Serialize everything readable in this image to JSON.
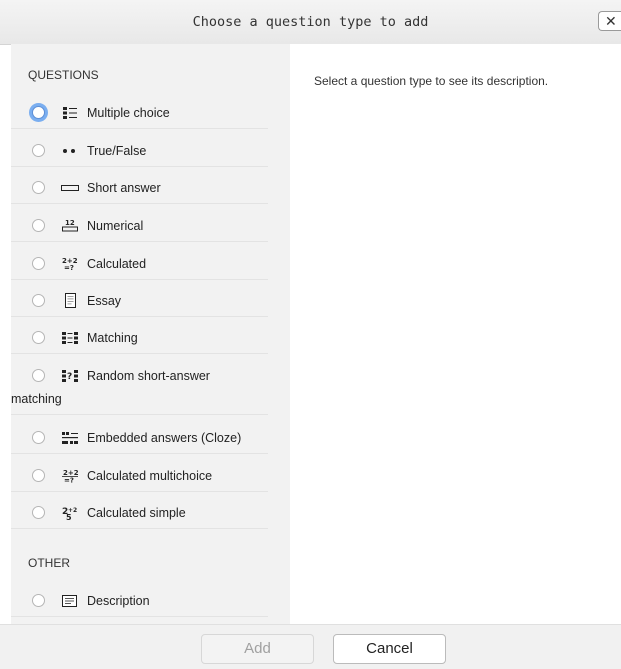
{
  "dialog": {
    "title": "Choose a question type to add",
    "close_label": "✕"
  },
  "categories": {
    "questions": "QUESTIONS",
    "other": "OTHER"
  },
  "options": [
    {
      "label": "Multiple choice",
      "icon": "multichoice-icon"
    },
    {
      "label": "True/False",
      "icon": "truefalse-icon"
    },
    {
      "label": "Short answer",
      "icon": "shortanswer-icon"
    },
    {
      "label": "Numerical",
      "icon": "numerical-icon"
    },
    {
      "label": "Calculated",
      "icon": "calculated-icon"
    },
    {
      "label": "Essay",
      "icon": "essay-icon"
    },
    {
      "label": "Matching",
      "icon": "matching-icon"
    },
    {
      "label": "Random short-answer",
      "label_line2": "matching",
      "icon": "randomsamatch-icon"
    },
    {
      "label": "Embedded answers (Cloze)",
      "icon": "cloze-icon"
    },
    {
      "label": "Calculated multichoice",
      "icon": "calculatedmulti-icon"
    },
    {
      "label": "Calculated simple",
      "icon": "calculatedsimple-icon"
    },
    {
      "label": "Description",
      "icon": "description-icon"
    }
  ],
  "description_placeholder": "Select a question type to see its description.",
  "footer": {
    "add_label": "Add",
    "cancel_label": "Cancel"
  },
  "colors": {
    "focus_ring": "#7aaef0",
    "left_panel_bg": "#f2f2f2"
  }
}
